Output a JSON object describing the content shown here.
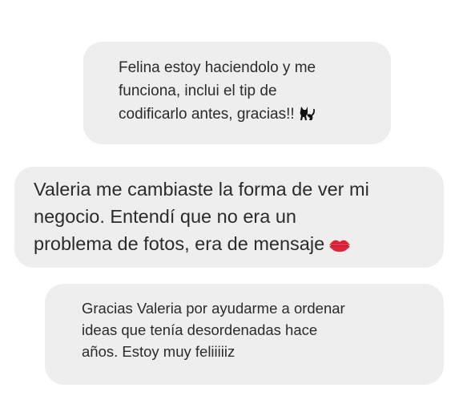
{
  "messages": [
    {
      "text": "Felina estoy haciendolo y me\nfunciona, inclui el tip de\ncodificarlo antes, gracias!!",
      "emoji": "black-cat-icon"
    },
    {
      "text": "Valeria me cambiaste la forma de ver mi\nnegocio. Entendí que no era un\nproblema de fotos, era de mensaje",
      "emoji": "kiss-mark-icon"
    },
    {
      "text": "Gracias Valeria por ayudarme a ordenar\nideas que tenía desordenadas hace\naños. Estoy muy feliiiiiz",
      "emoji": ""
    }
  ],
  "colors": {
    "bubble": "#eeeeee",
    "text": "#2b2b2b",
    "lips": "#e0233a"
  }
}
